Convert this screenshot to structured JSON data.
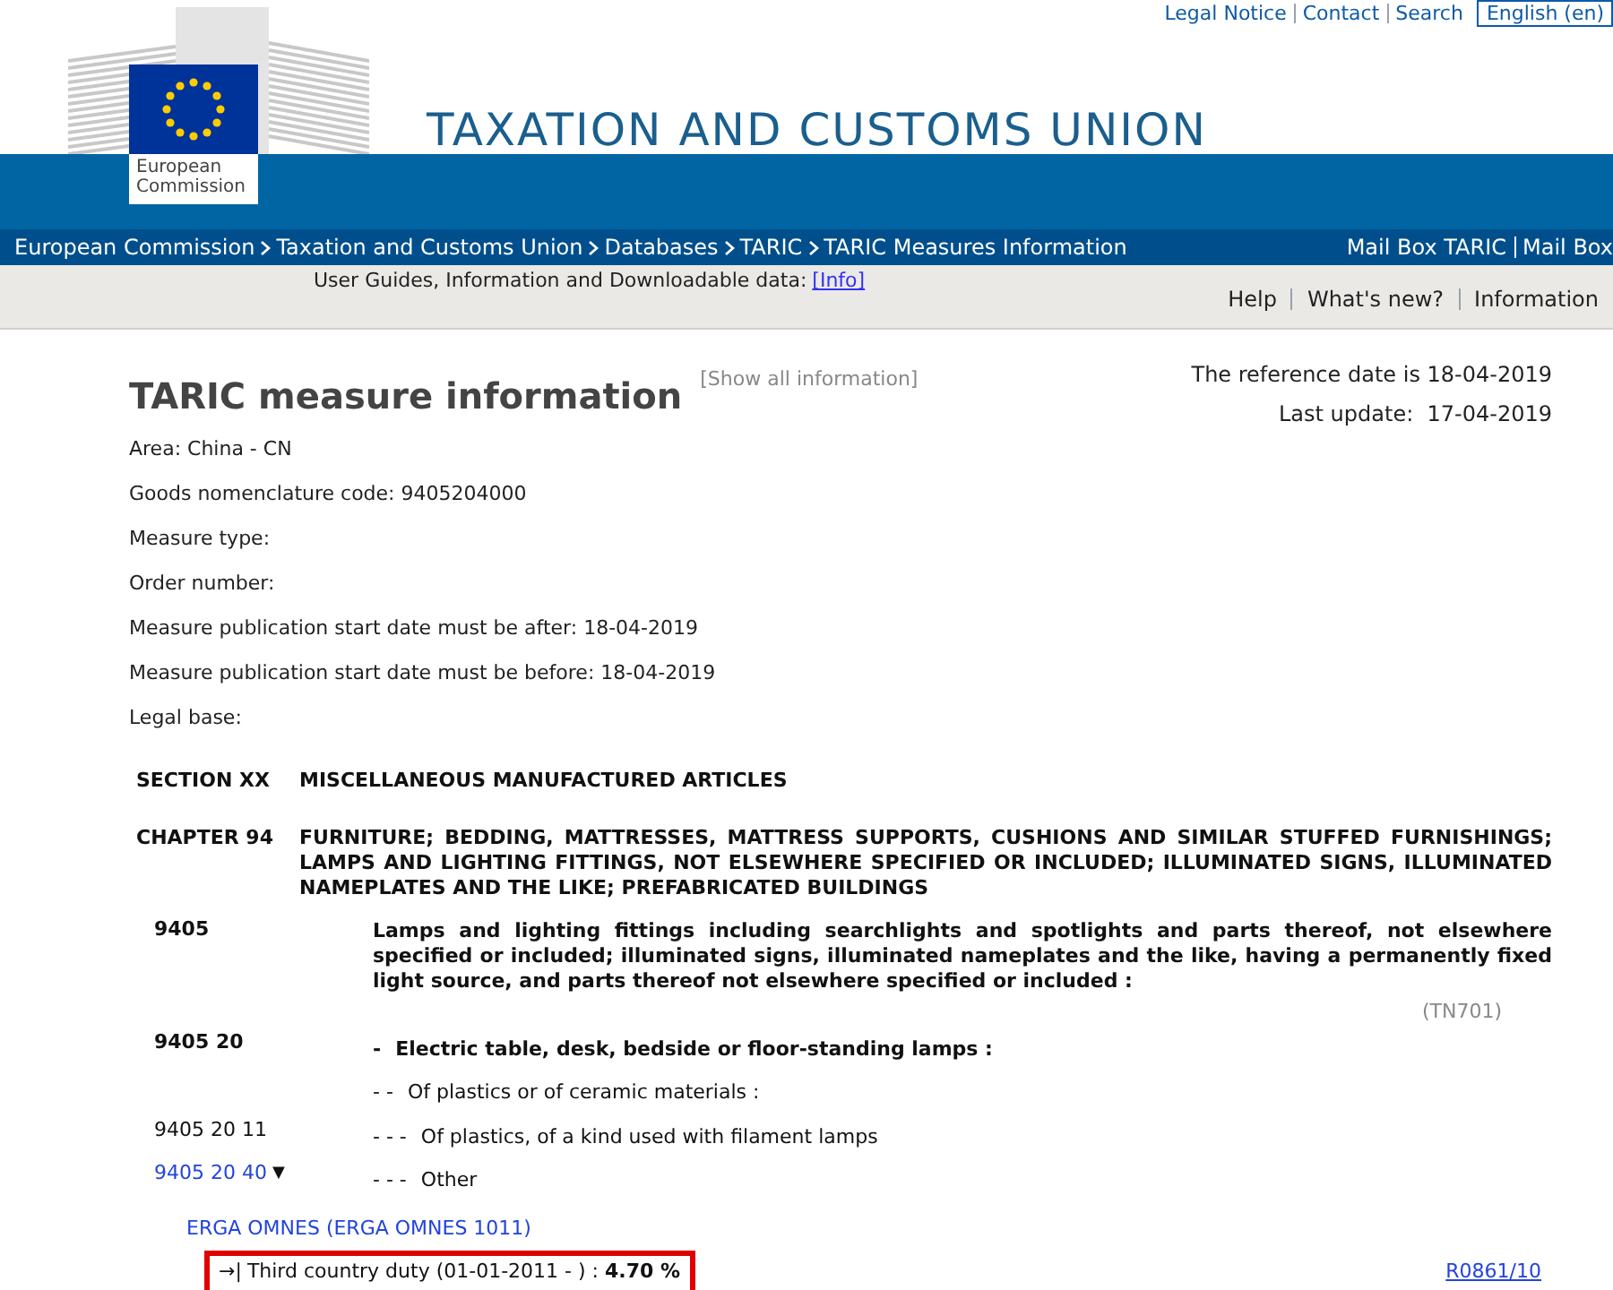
{
  "top_links": [
    "Legal Notice",
    "Contact",
    "Search"
  ],
  "language": "English (en)",
  "logo": {
    "line1": "European",
    "line2": "Commission"
  },
  "site_title": "TAXATION AND CUSTOMS UNION",
  "breadcrumb": [
    "European Commission",
    "Taxation and Customs Union",
    "Databases",
    "TARIC",
    "TARIC Measures Information"
  ],
  "mailbox_links": [
    "Mail Box TARIC",
    "Mail Box"
  ],
  "guides": {
    "text": "User Guides, Information and Downloadable data:",
    "link": "[Info]"
  },
  "nav_links": [
    "Help",
    "What's new?",
    "Information"
  ],
  "page_title": "TARIC measure information",
  "show_all": "[Show all information]",
  "reference_date": "The reference date is 18-04-2019",
  "last_update": "Last update:  17-04-2019",
  "fields": [
    "Area: China - CN",
    "Goods nomenclature code: 9405204000",
    "Measure type:",
    "Order number:",
    "Measure publication start date must be after: 18-04-2019",
    "Measure publication start date must be before: 18-04-2019",
    "Legal base:"
  ],
  "section": {
    "label": "SECTION XX",
    "text": "MISCELLANEOUS MANUFACTURED ARTICLES"
  },
  "chapter": {
    "label": "CHAPTER 94",
    "text": "FURNITURE; BEDDING, MATTRESSES, MATTRESS SUPPORTS, CUSHIONS AND SIMILAR STUFFED FURNISHINGS; LAMPS AND LIGHTING FITTINGS, NOT ELSEWHERE SPECIFIED OR INCLUDED; ILLUMINATED SIGNS, ILLUMINATED NAMEPLATES AND THE LIKE; PREFABRICATED BUILDINGS"
  },
  "goods": [
    {
      "kind": "heading",
      "code": "9405",
      "text": "Lamps and lighting fittings including searchlights and spotlights and parts thereof, not elsewhere specified or included; illuminated signs, illuminated nameplates and the like, having a permanently fixed light source, and parts thereof not elsewhere specified or included :",
      "note": "(TN701)"
    },
    {
      "kind": "subheading",
      "code": "9405 20",
      "dashes": "-",
      "text": "Electric table, desk, bedside or floor-standing lamps :"
    },
    {
      "kind": "plain",
      "dashes": "- -",
      "text": "Of plastics or of ceramic materials :"
    },
    {
      "kind": "plain",
      "code": "9405 20 11",
      "dashes": "- - -",
      "text": "Of plastics, of a kind used with filament lamps"
    },
    {
      "kind": "link",
      "code": "9405 20 40",
      "caret": "▼",
      "dashes": "- - -",
      "text": "Other"
    }
  ],
  "origin": "ERGA OMNES (ERGA OMNES 1011)",
  "measure": {
    "arrow": "→|",
    "text": "Third country duty (01-01-2011 - ) : **4.70 %**",
    "highlighted": true,
    "regulation": "R0861/10"
  }
}
